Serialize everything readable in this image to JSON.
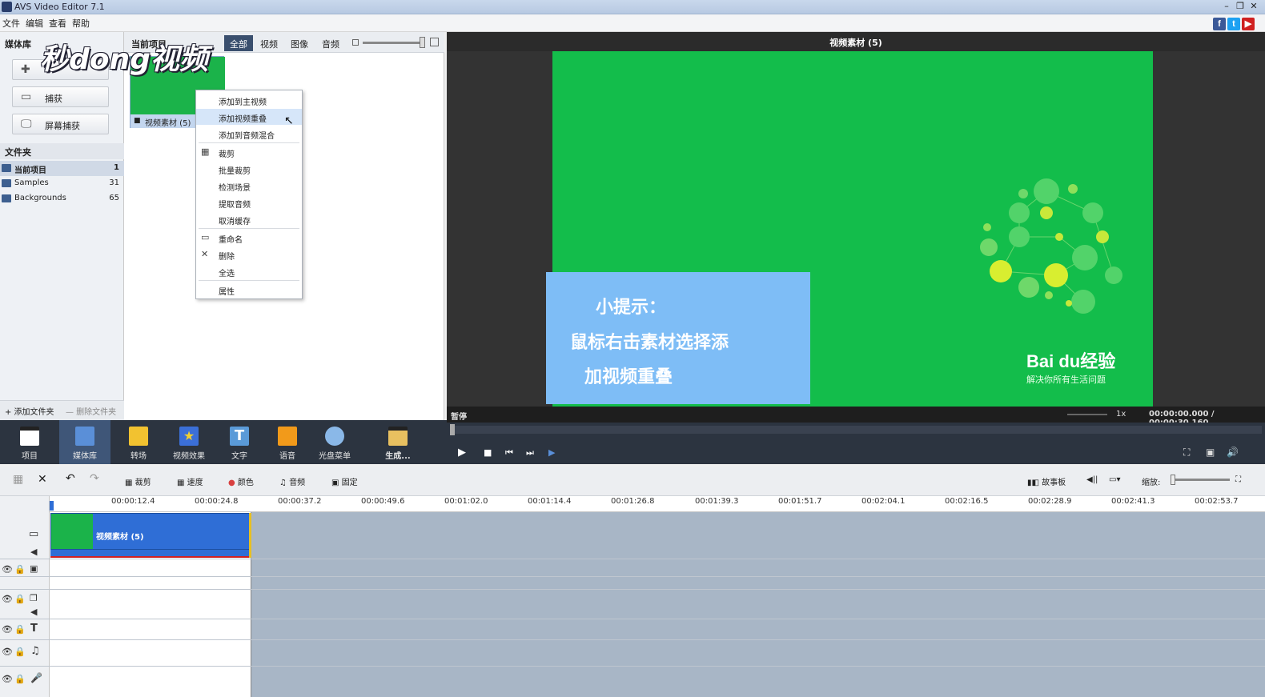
{
  "window": {
    "title": "AVS Video Editor 7.1"
  },
  "menu": [
    "文件",
    "编辑",
    "查看",
    "帮助"
  ],
  "left_panel": {
    "header": "媒体库",
    "buttons": [
      {
        "icon": "plus-icon",
        "label": ""
      },
      {
        "icon": "camera-icon",
        "label": "捕获"
      },
      {
        "icon": "monitor-icon",
        "label": "屏幕捕获"
      }
    ],
    "folders_header": "文件夹",
    "folders": [
      {
        "name": "当前项目",
        "count": "1"
      },
      {
        "name": "Samples",
        "count": "31"
      },
      {
        "name": "Backgrounds",
        "count": "65"
      }
    ],
    "add_folder": "+ 添加文件夹",
    "delete_folder": "— 删除文件夹"
  },
  "media": {
    "header": "当前项目",
    "tabs": [
      "全部",
      "视频",
      "图像",
      "音频"
    ],
    "active_tab": "全部",
    "item_label": "视频素材 (5)"
  },
  "context_menu": [
    {
      "label": "添加到主视频"
    },
    {
      "label": "添加视频重叠",
      "highlight": true
    },
    {
      "label": "添加到音频混合"
    },
    {
      "label": "裁剪",
      "icon": "film-icon"
    },
    {
      "label": "批量裁剪"
    },
    {
      "label": "检测场景"
    },
    {
      "label": "提取音频"
    },
    {
      "label": "取消缓存"
    },
    {
      "label": "重命名",
      "icon": "rename-icon"
    },
    {
      "label": "删除",
      "icon": "close-icon"
    },
    {
      "label": "全选"
    },
    {
      "label": "属性"
    }
  ],
  "watermark": "秒dong视频",
  "preview": {
    "title": "视频素材 (5)",
    "tip_title": "小提示：",
    "tip_line1": "鼠标右击素材选择添",
    "tip_line2": "加视频重叠",
    "brand": "Bai du经验",
    "brand_sub": "解决你所有生活问题",
    "status": "暂停",
    "speed": "1x",
    "time": "00:00:00.000 / 00:00:30.160"
  },
  "toolbar": [
    {
      "label": "项目",
      "color": "#ffffff"
    },
    {
      "label": "媒体库",
      "color": "#5a8fd8"
    },
    {
      "label": "转场",
      "color": "#f2c230"
    },
    {
      "label": "视频效果",
      "color": "#3b6fd8"
    },
    {
      "label": "文字",
      "color": "#5a9ad8"
    },
    {
      "label": "语音",
      "color": "#f29a1a"
    },
    {
      "label": "光盘菜单",
      "color": "#8ab8e8"
    },
    {
      "label": "生成...",
      "color": "#e8c060"
    }
  ],
  "timeline_toolbar": {
    "crop": "裁剪",
    "speed": "速度",
    "color": "颜色",
    "audio": "音频",
    "freeze": "固定",
    "storyboard": "故事板",
    "zoom": "缩放:"
  },
  "ruler": [
    "00:00:12.4",
    "00:00:24.8",
    "00:00:37.2",
    "00:00:49.6",
    "00:01:02.0",
    "00:01:14.4",
    "00:01:26.8",
    "00:01:39.3",
    "00:01:51.7",
    "00:02:04.1",
    "00:02:16.5",
    "00:02:28.9",
    "00:02:41.3",
    "00:02:53.7"
  ],
  "timeline": {
    "clip_label": "视频素材 (5)"
  }
}
